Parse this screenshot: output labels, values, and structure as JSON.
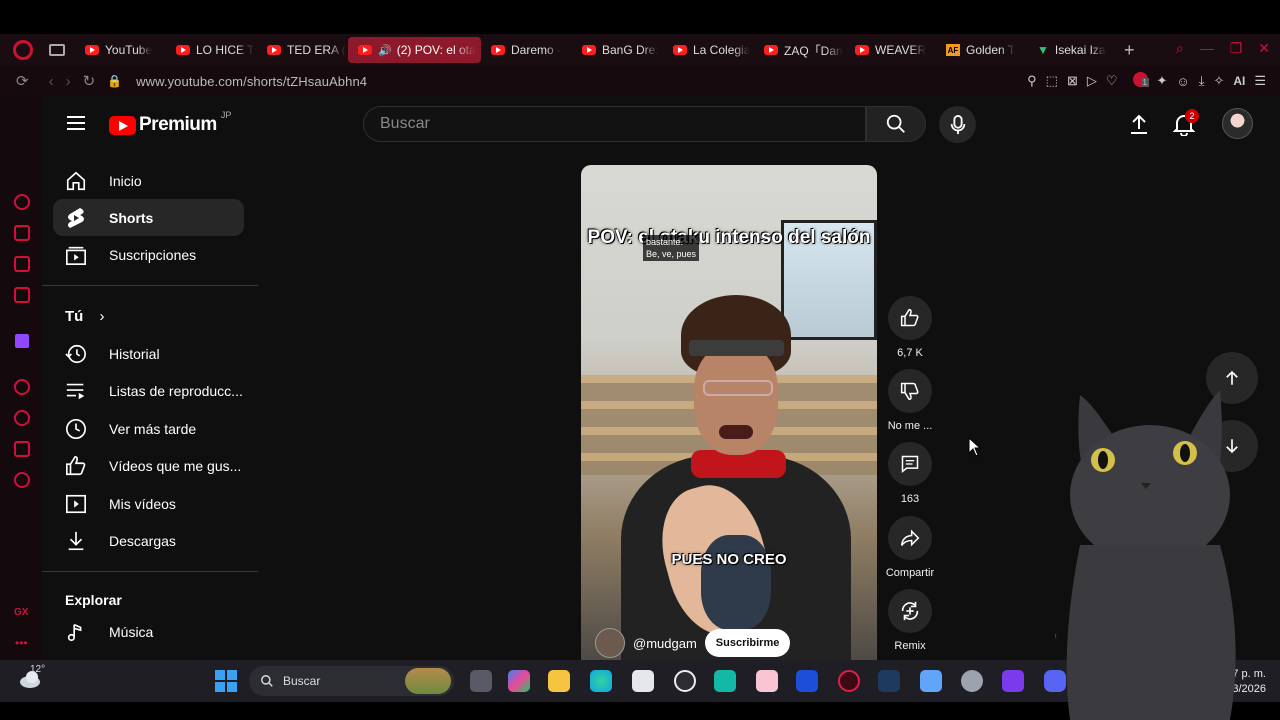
{
  "browser": {
    "tabs": [
      {
        "label": "YouTube",
        "icon": "youtube-icon"
      },
      {
        "label": "LO HICE T",
        "icon": "youtube-icon"
      },
      {
        "label": "TED ERA (",
        "icon": "youtube-icon"
      },
      {
        "label": "(2) POV: el ota",
        "icon": "speaker-icon",
        "active": true
      },
      {
        "label": "Daremo -",
        "icon": "youtube-icon"
      },
      {
        "label": "BanG Dre:",
        "icon": "youtube-icon"
      },
      {
        "label": "La Colegia",
        "icon": "youtube-icon"
      },
      {
        "label": "ZAQ「Dan",
        "icon": "youtube-icon"
      },
      {
        "label": "WEAVER",
        "icon": "youtube-icon"
      },
      {
        "label": "Golden T",
        "icon": "af-icon"
      },
      {
        "label": "Isekai Iza",
        "icon": "v-icon"
      }
    ],
    "url": "www.youtube.com/shorts/tZHsauAbhn4",
    "ai_label": "AI",
    "badge_count": "1"
  },
  "youtube": {
    "logo_text": "Premium",
    "logo_region": "JP",
    "search_placeholder": "Buscar",
    "notification_count": "2",
    "sidebar": {
      "primary": [
        {
          "label": "Inicio",
          "icon": "home-icon"
        },
        {
          "label": "Shorts",
          "icon": "shorts-icon",
          "active": true
        },
        {
          "label": "Suscripciones",
          "icon": "subscriptions-icon"
        }
      ],
      "you_heading": "Tú",
      "you_items": [
        {
          "label": "Historial",
          "icon": "history-icon"
        },
        {
          "label": "Listas de reproducc...",
          "icon": "playlist-icon"
        },
        {
          "label": "Ver más tarde",
          "icon": "clock-icon"
        },
        {
          "label": "Vídeos que me gus...",
          "icon": "thumbs-up-icon"
        },
        {
          "label": "Mis vídeos",
          "icon": "video-icon"
        },
        {
          "label": "Descargas",
          "icon": "download-icon"
        }
      ],
      "explore_heading": "Explorar",
      "explore_items": [
        {
          "label": "Música",
          "icon": "music-note-icon"
        }
      ]
    },
    "short": {
      "caption_title": "POV: el otaku intenso del salón",
      "cc_text": [
        "bastante.",
        "Be, ve, pues"
      ],
      "caption_bottom": "PUES NO CREO",
      "channel": "@mudgam",
      "subscribe_label": "Suscribirme"
    },
    "actions": [
      {
        "label": "6,7 K",
        "icon": "like-icon"
      },
      {
        "label": "No me ...",
        "icon": "dislike-icon"
      },
      {
        "label": "163",
        "icon": "comment-icon"
      },
      {
        "label": "Compartir",
        "icon": "share-icon"
      },
      {
        "label": "Remix",
        "icon": "remix-icon"
      }
    ]
  },
  "taskbar": {
    "temperature": "12°",
    "search_label": "Buscar",
    "time": "9:07 p. m.",
    "date": "22/03/2026"
  },
  "colors": {
    "opera_red": "#d01030",
    "youtube_red": "#ff0000",
    "active_tab": "#8c1a2c"
  }
}
